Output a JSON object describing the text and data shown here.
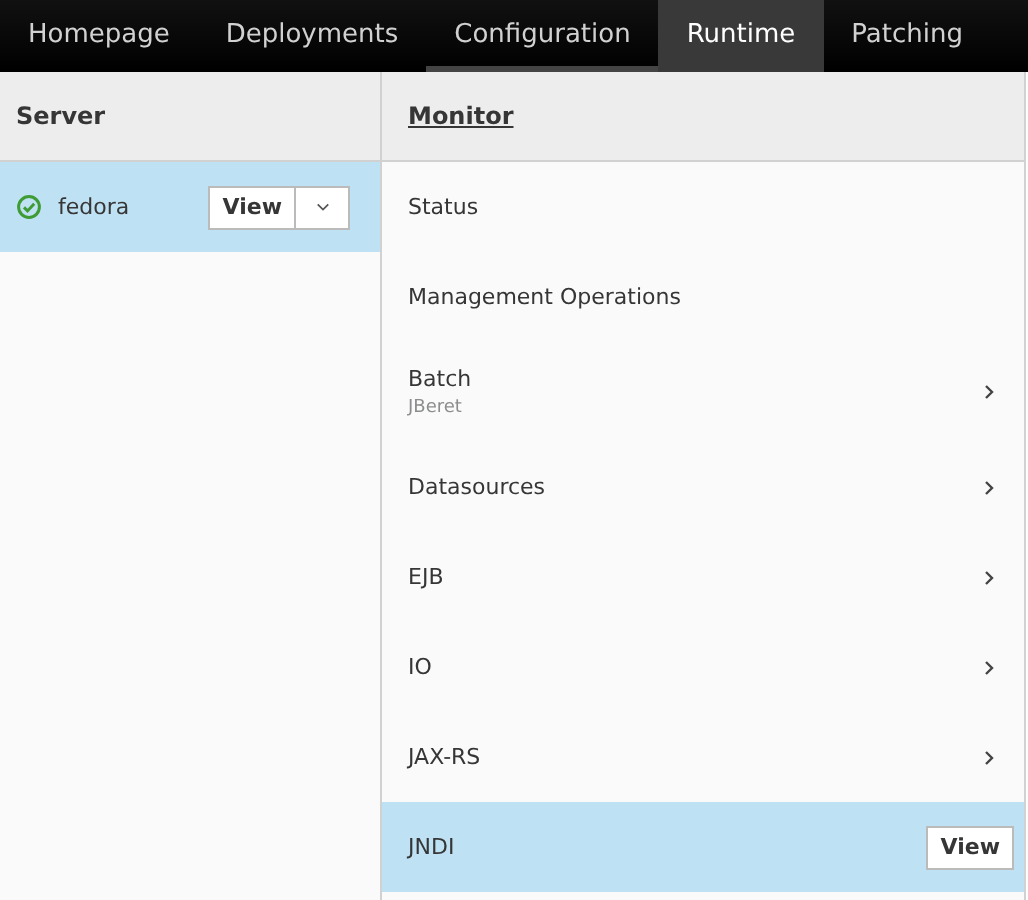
{
  "tabs": [
    {
      "label": "Homepage",
      "selected": false,
      "hovered": false
    },
    {
      "label": "Deployments",
      "selected": false,
      "hovered": false
    },
    {
      "label": "Configuration",
      "selected": false,
      "hovered": true
    },
    {
      "label": "Runtime",
      "selected": true,
      "hovered": false
    },
    {
      "label": "Patching",
      "selected": false,
      "hovered": false
    }
  ],
  "server_column": {
    "title": "Server",
    "items": [
      {
        "name": "fedora",
        "healthy": true,
        "selected": true,
        "button": "View",
        "dropdown": true
      }
    ]
  },
  "monitor_column": {
    "title": "Monitor",
    "items": [
      {
        "label": "Status",
        "has_children": false,
        "selected": false
      },
      {
        "label": "Management Operations",
        "has_children": false,
        "selected": false
      },
      {
        "label": "Batch",
        "subtitle": "JBeret",
        "has_children": true,
        "selected": false
      },
      {
        "label": "Datasources",
        "has_children": true,
        "selected": false
      },
      {
        "label": "EJB",
        "has_children": true,
        "selected": false
      },
      {
        "label": "IO",
        "has_children": true,
        "selected": false
      },
      {
        "label": "JAX-RS",
        "has_children": true,
        "selected": false
      },
      {
        "label": "JNDI",
        "has_children": false,
        "selected": true,
        "button": "View"
      }
    ]
  }
}
